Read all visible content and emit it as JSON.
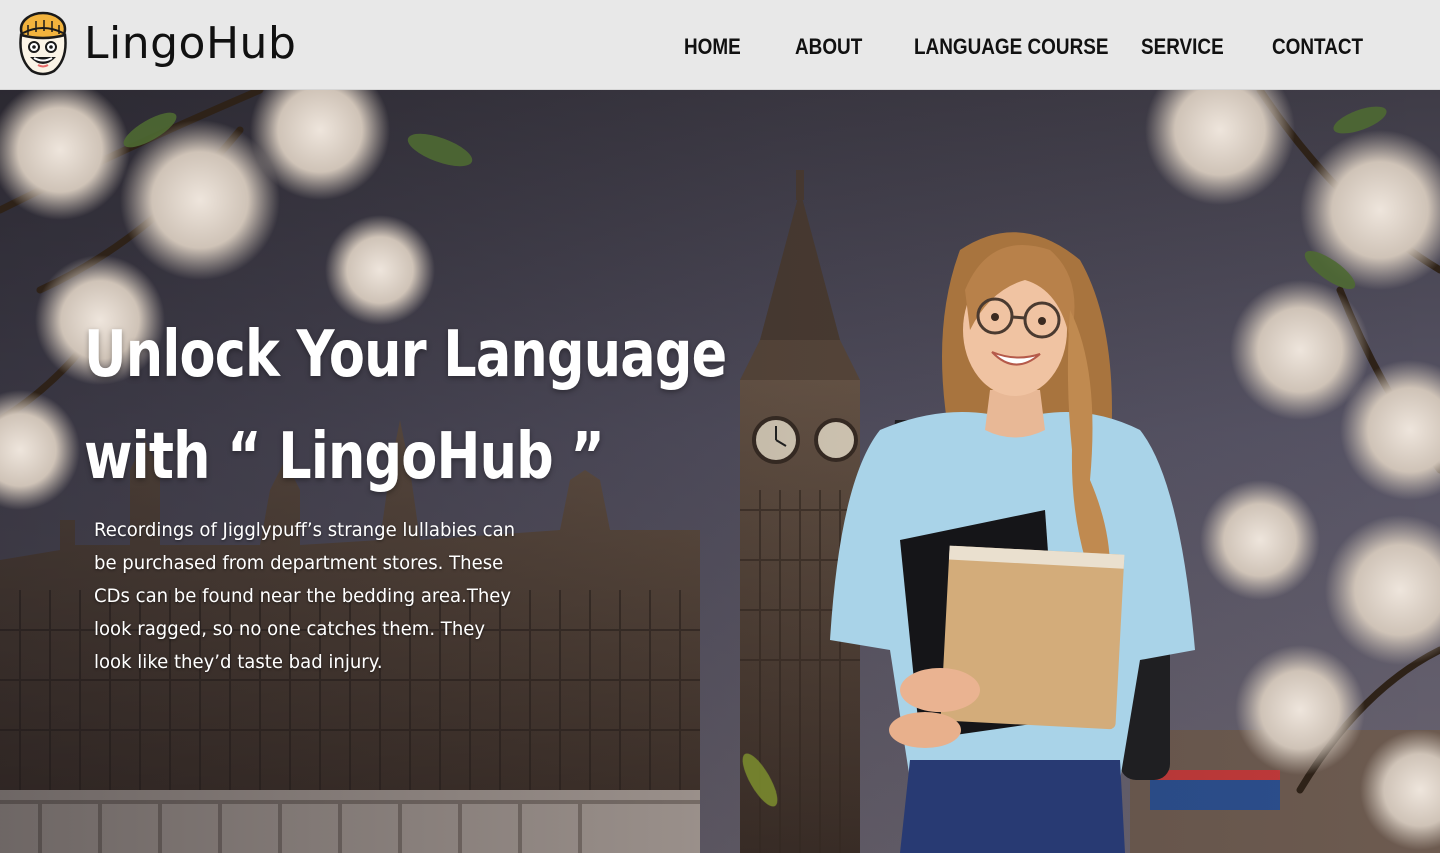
{
  "brand": {
    "name": "LingoHub",
    "logo_icon": "smiling-face-beanie-icon"
  },
  "nav": {
    "items": [
      {
        "label": "HOME"
      },
      {
        "label": "ABOUT"
      },
      {
        "label": "LANGUAGE COURSE"
      },
      {
        "label": "SERVICE"
      },
      {
        "label": "CONTACT"
      }
    ]
  },
  "hero": {
    "title_line1": "Unlock Your Language",
    "title_line2": "with “ LingoHub ”",
    "description_lines": [
      "Recordings of Jigglypuff’s strange lullabies can",
      "be purchased from department stores. These",
      "CDs can be found near the bedding area.They",
      "look ragged, so no one catches them. They",
      "look like they’d taste bad injury."
    ]
  },
  "colors": {
    "header_bg": "#e8e8e8",
    "nav_text": "#111111",
    "hero_text": "#ffffff",
    "logo_accent": "#f2b33d"
  }
}
